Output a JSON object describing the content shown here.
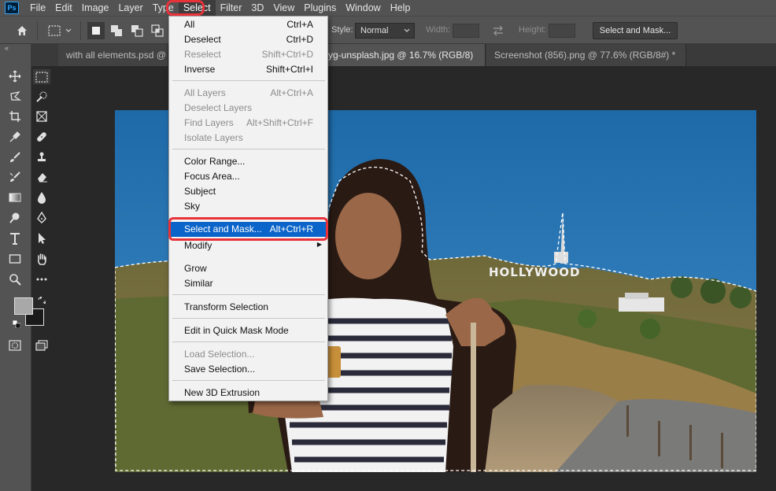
{
  "menubar": {
    "logo": "Ps",
    "items": [
      "File",
      "Edit",
      "Image",
      "Layer",
      "Type",
      "Select",
      "Filter",
      "3D",
      "View",
      "Plugins",
      "Window",
      "Help"
    ],
    "active": "Select"
  },
  "options": {
    "style_label": "Style:",
    "style_value": "Normal",
    "width_label": "Width:",
    "height_label": "Height:",
    "select_mask_button": "Select and Mask..."
  },
  "tabs": [
    {
      "label": "with all elements.psd @ 1",
      "active": false
    },
    {
      "label": "yg-unsplash.jpg @ 16.7% (RGB/8)",
      "active": true
    },
    {
      "label": "Screenshot (856).png @ 77.6% (RGB/8#) *",
      "active": false
    }
  ],
  "tab_close_glyph": "×",
  "toolbar": {
    "collapse": "«"
  },
  "select_menu": {
    "items": [
      {
        "label": "All",
        "shortcut": "Ctrl+A",
        "disabled": false
      },
      {
        "label": "Deselect",
        "shortcut": "Ctrl+D",
        "disabled": false
      },
      {
        "label": "Reselect",
        "shortcut": "Shift+Ctrl+D",
        "disabled": true
      },
      {
        "label": "Inverse",
        "shortcut": "Shift+Ctrl+I",
        "disabled": false
      },
      {
        "label": "All Layers",
        "shortcut": "Alt+Ctrl+A",
        "disabled": true
      },
      {
        "label": "Deselect Layers",
        "shortcut": "",
        "disabled": true
      },
      {
        "label": "Find Layers",
        "shortcut": "Alt+Shift+Ctrl+F",
        "disabled": true
      },
      {
        "label": "Isolate Layers",
        "shortcut": "",
        "disabled": true
      },
      {
        "label": "Color Range...",
        "shortcut": "",
        "disabled": false
      },
      {
        "label": "Focus Area...",
        "shortcut": "",
        "disabled": false
      },
      {
        "label": "Subject",
        "shortcut": "",
        "disabled": false
      },
      {
        "label": "Sky",
        "shortcut": "",
        "disabled": false
      },
      {
        "label": "Select and Mask...",
        "shortcut": "Alt+Ctrl+R",
        "disabled": false,
        "highlighted": true
      },
      {
        "label": "Modify",
        "shortcut": "",
        "disabled": false,
        "submenu": true
      },
      {
        "label": "Grow",
        "shortcut": "",
        "disabled": false
      },
      {
        "label": "Similar",
        "shortcut": "",
        "disabled": false
      },
      {
        "label": "Transform Selection",
        "shortcut": "",
        "disabled": false
      },
      {
        "label": "Edit in Quick Mask Mode",
        "shortcut": "",
        "disabled": false
      },
      {
        "label": "Load Selection...",
        "shortcut": "",
        "disabled": true
      },
      {
        "label": "Save Selection...",
        "shortcut": "",
        "disabled": false
      },
      {
        "label": "New 3D Extrusion",
        "shortcut": "",
        "disabled": false
      }
    ]
  },
  "photo": {
    "sign_text": "HOLLYWOOD"
  },
  "colors": {
    "highlight": "#0a64c9",
    "annotation": "#e8323a",
    "sky": "#2d78b8"
  }
}
